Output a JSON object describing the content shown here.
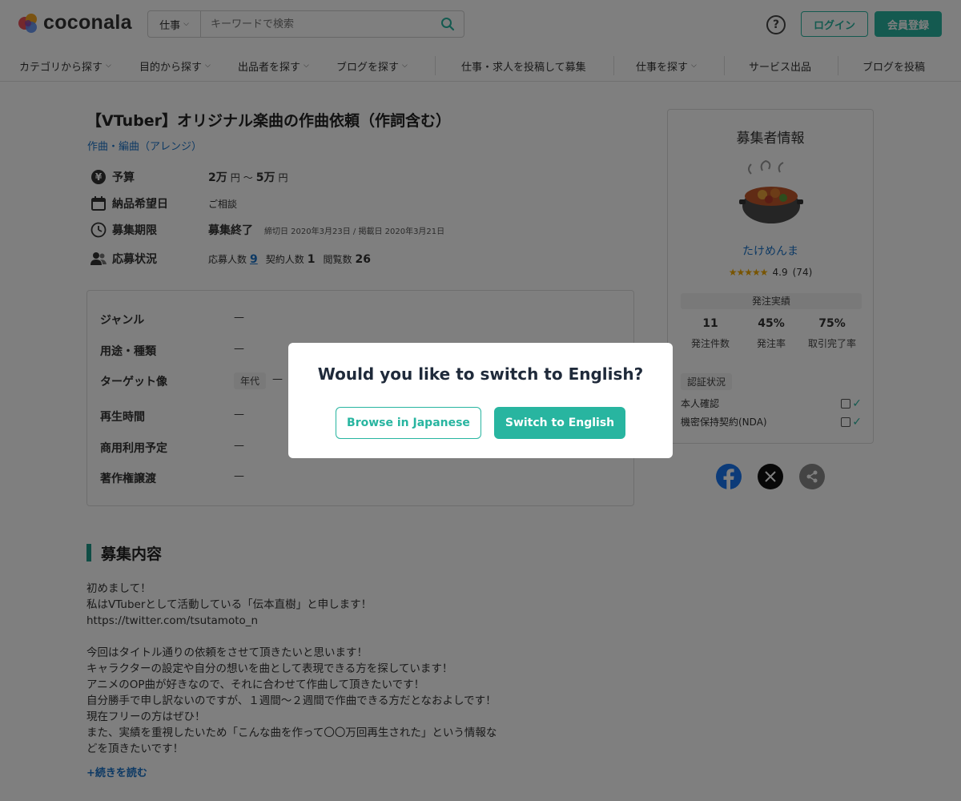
{
  "header": {
    "logo_text": "coconala",
    "search_category": "仕事",
    "search_placeholder": "キーワードで検索",
    "help_label": "?",
    "login_label": "ログイン",
    "register_label": "会員登録"
  },
  "nav": {
    "items": [
      "カテゴリから探す",
      "目的から探す",
      "出品者を探す",
      "ブログを探す",
      "仕事・求人を投稿して募集",
      "仕事を探す",
      "サービス出品",
      "ブログを投稿"
    ]
  },
  "job": {
    "title": "【VTuber】オリジナル楽曲の作曲依頼（作詞含む）",
    "category": "作曲・編曲（アレンジ）",
    "budget_label": "予算",
    "budget_min": "2万",
    "budget_unit": "円",
    "budget_sep": "～",
    "budget_max": "5万",
    "delivery_label": "納品希望日",
    "delivery_value": "ご相談",
    "deadline_label": "募集期限",
    "deadline_value": "募集終了",
    "deadline_dates": "締切日 2020年3月23日 / 掲載日 2020年3月21日",
    "status_label": "応募状況",
    "applicants_label": "応募人数",
    "applicants": "9",
    "contracts_label": "契約人数",
    "contracts": "1",
    "views_label": "閲覧数",
    "views": "26"
  },
  "specs": {
    "genre_label": "ジャンル",
    "genre_value": "—",
    "usage_label": "用途・種類",
    "usage_value": "—",
    "target_label": "ターゲット像",
    "target_age_chip": "年代",
    "target_value": "—",
    "playtime_label": "再生時間",
    "playtime_value": "—",
    "commercial_label": "商用利用予定",
    "commercial_value": "—",
    "copyright_label": "著作権譲渡",
    "copyright_value": "—"
  },
  "description": {
    "heading": "募集内容",
    "lines": [
      "初めまして！",
      "私はVTuberとして活動している「伝本直樹」と申します！",
      "https://twitter.com/tsutamoto_n",
      "",
      "今回はタイトル通りの依頼をさせて頂きたいと思います！",
      "キャラクターの設定や自分の想いを曲として表現できる方を探しています！",
      "アニメのOP曲が好きなので、それに合わせて作曲して頂きたいです！",
      "自分勝手で申し訳ないのですが、１週間～２週間で作曲できる方だとなおよしです！",
      "現在フリーの方はぜひ！",
      "また、実績を重視したいため「こんな曲を作って〇〇万回再生された」という情報な",
      "どを頂きたいです！"
    ],
    "read_more": "+続きを読む"
  },
  "sidebar": {
    "title": "募集者情報",
    "username": "たけめんま",
    "stars": "★★★★★",
    "rating": "4.9",
    "review_count": "(74)",
    "performance_label": "発注実績",
    "stats": [
      {
        "value": "11",
        "label": "発注件数"
      },
      {
        "value": "45%",
        "label": "発注率"
      },
      {
        "value": "75%",
        "label": "取引完了率"
      }
    ],
    "cert_label": "認証状況",
    "cert_identity": "本人確認",
    "cert_nda": "機密保持契約(NDA)"
  },
  "modal": {
    "title": "Would you like to switch to English?",
    "browse_japanese": "Browse in Japanese",
    "switch_english": "Switch to English"
  },
  "colors": {
    "accent": "#28b5a0",
    "link": "#1a73c8",
    "overlay": "rgba(0,0,0,0.5)"
  }
}
